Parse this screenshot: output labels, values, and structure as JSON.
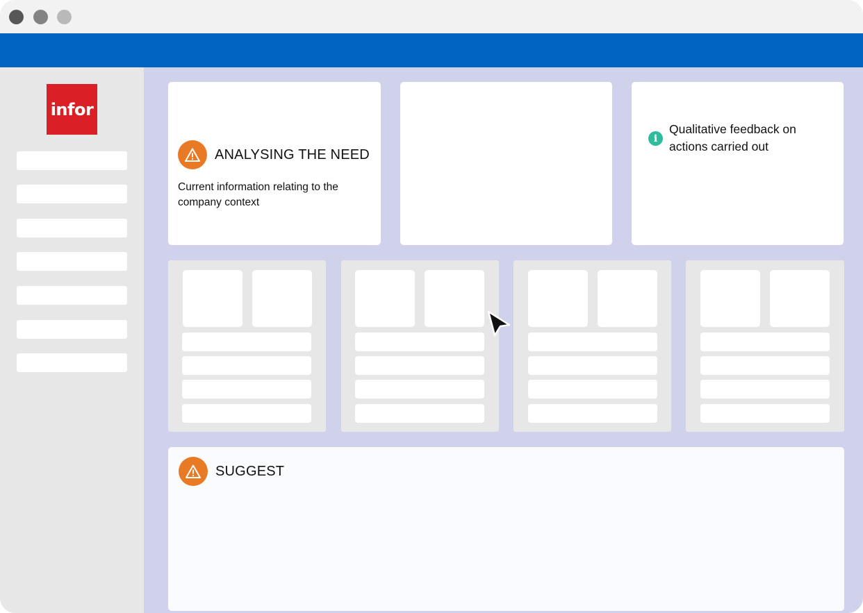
{
  "window": {
    "traffic_lights": [
      "close",
      "minimize",
      "zoom"
    ],
    "colors": {
      "topbar": "#0163c2",
      "sidebar": "#e7e7e7",
      "main_bg": "#d0d1ea",
      "accent_warning": "#e97a25",
      "accent_info": "#2ebc9c"
    }
  },
  "sidebar": {
    "logo_text": "infor",
    "logo_color": "#da1f26",
    "nav_item_count": 7
  },
  "cards": {
    "need": {
      "icon": "warning-icon",
      "title": "ANALYSING THE NEED",
      "description": "Current information relating to the company context"
    },
    "feedback": {
      "icon": "info-icon",
      "text": "Qualitative feedback on actions carried out"
    },
    "suggest": {
      "icon": "warning-icon",
      "title": "SUGGEST"
    }
  },
  "panels": {
    "count": 4,
    "tiles_per_panel": 2,
    "rows_per_panel": 4
  },
  "cursor": {
    "icon": "mouse-pointer-icon"
  }
}
